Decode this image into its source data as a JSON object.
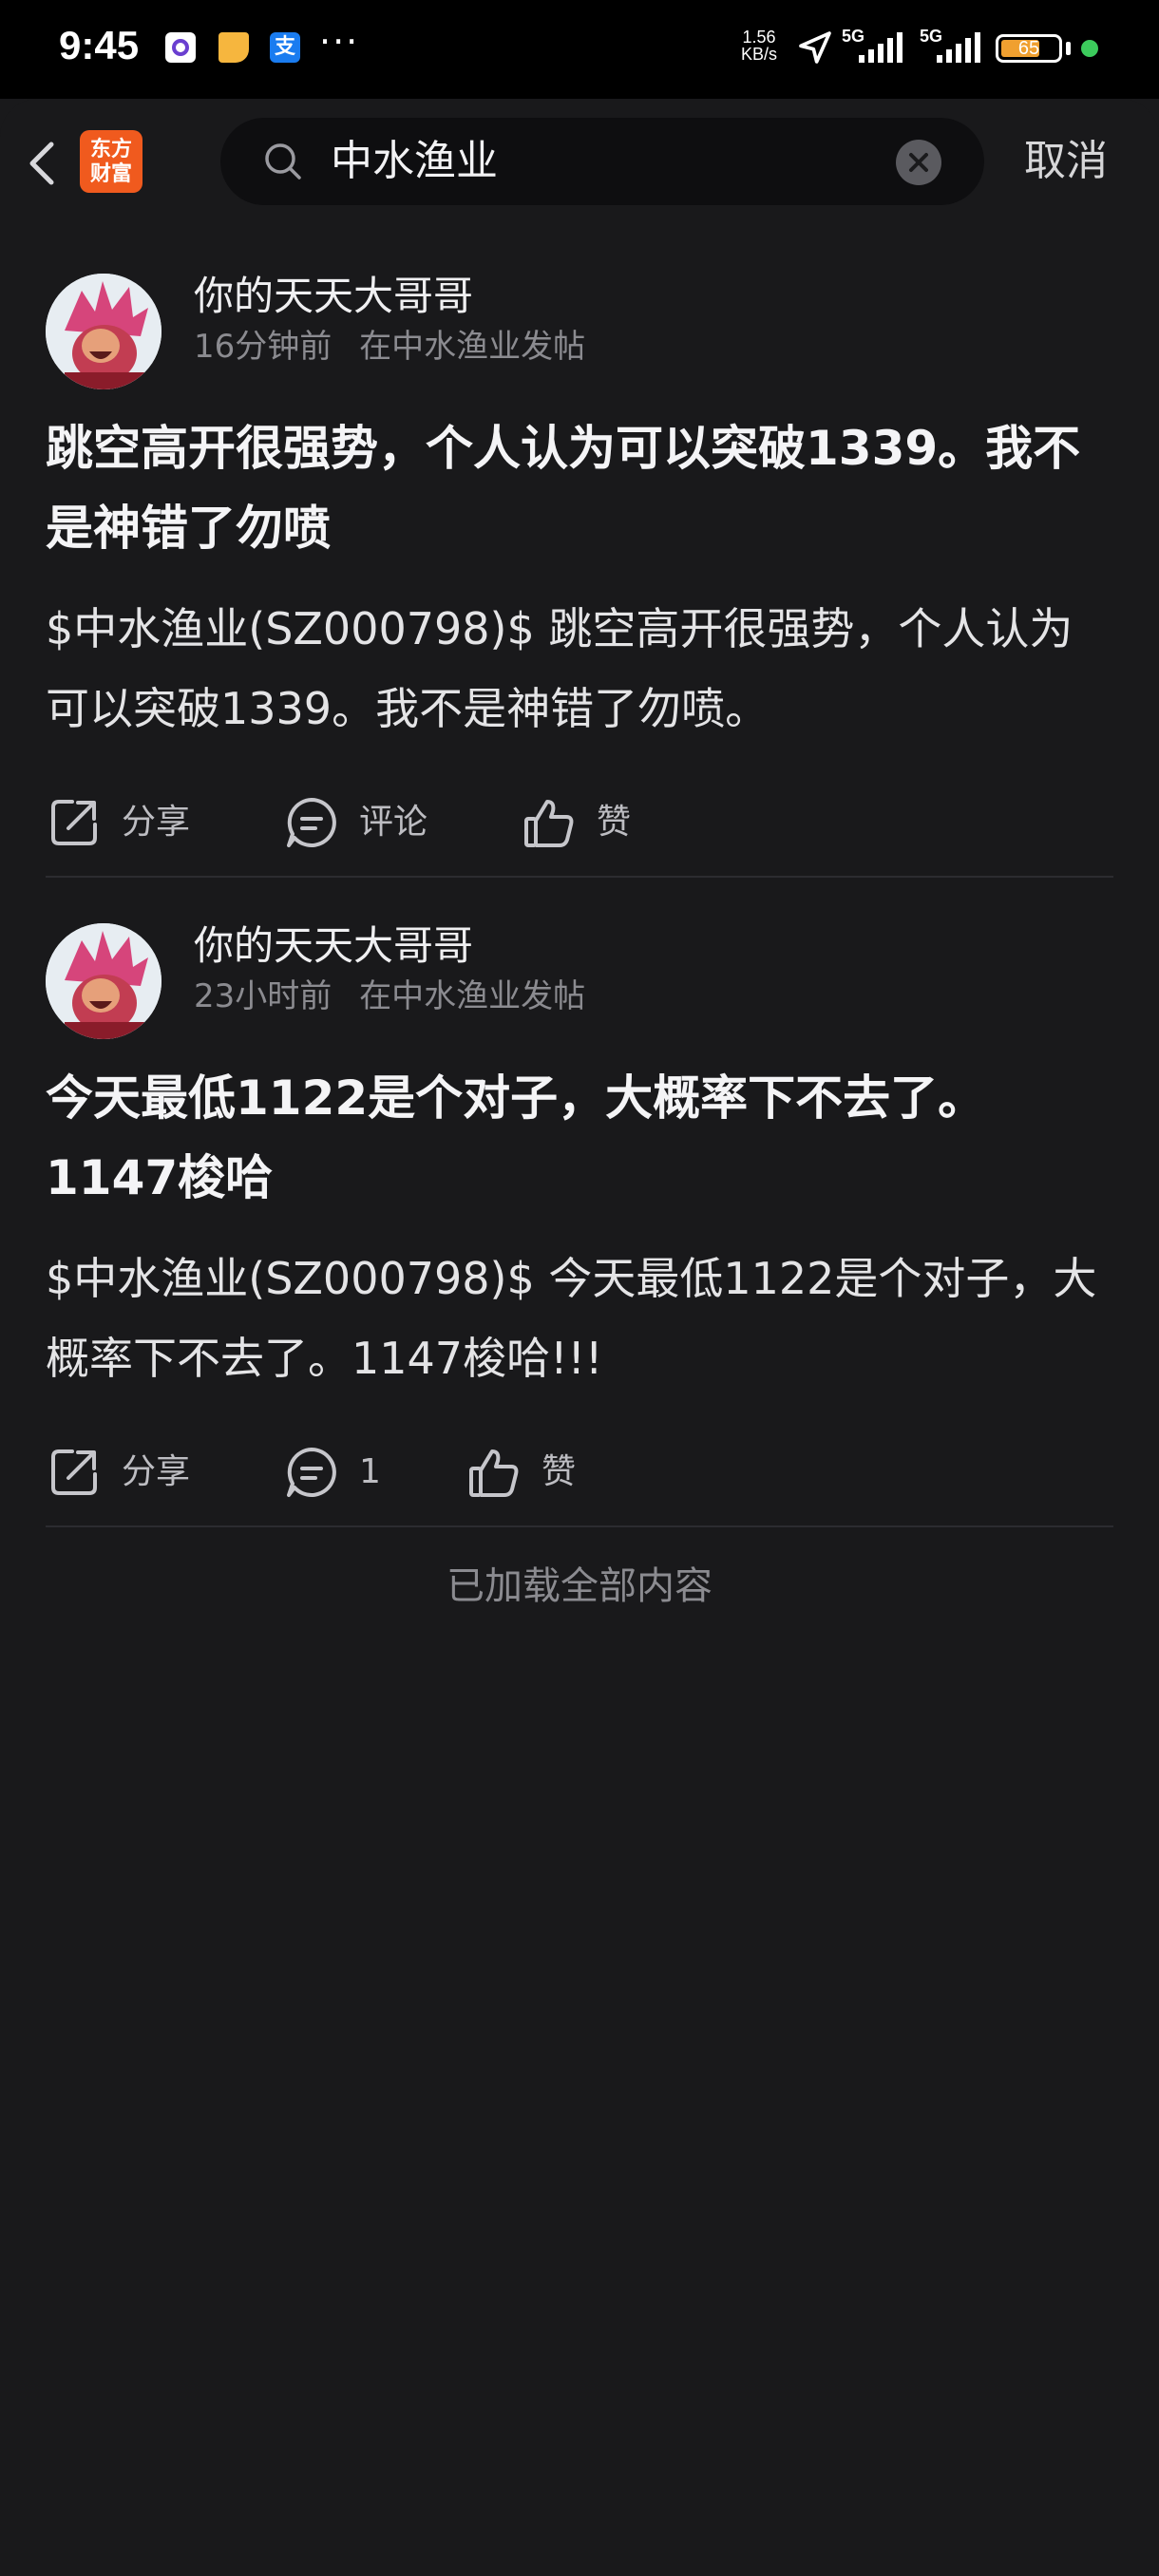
{
  "status_bar": {
    "time": "9:45",
    "more_dots": "···",
    "net_speed_value": "1.56",
    "net_speed_unit": "KB/s",
    "network_1": "5G",
    "network_2": "5G",
    "battery": "65",
    "notif_icons": [
      "circle-app-icon",
      "note-icon",
      "alipay-icon"
    ]
  },
  "header": {
    "app_logo_line1": "东方",
    "app_logo_line2": "财富",
    "search_value": "中水渔业",
    "cancel_label": "取消"
  },
  "posts": [
    {
      "username": "你的天天大哥哥",
      "time": "16分钟前",
      "location": "在中水渔业发帖",
      "title": "跳空高开很强势，个人认为可以突破1339。我不是神错了勿喷",
      "body": "$中水渔业(SZ000798)$ 跳空高开很强势，个人认为可以突破1339。我不是神错了勿喷。",
      "share_label": "分享",
      "comment_label": "评论",
      "like_label": "赞"
    },
    {
      "username": "你的天天大哥哥",
      "time": "23小时前",
      "location": "在中水渔业发帖",
      "title": "今天最低1122是个对子，大概率下不去了。1147梭哈",
      "body": "$中水渔业(SZ000798)$ 今天最低1122是个对子，大概率下不去了。1147梭哈!!!",
      "share_label": "分享",
      "comment_label": "1",
      "like_label": "赞"
    }
  ],
  "footer": {
    "loaded_text": "已加载全部内容"
  },
  "colors": {
    "background": "#19191b",
    "logo": "#f05a1e",
    "battery": "#f0a030",
    "online_dot": "#3ccb5c"
  }
}
